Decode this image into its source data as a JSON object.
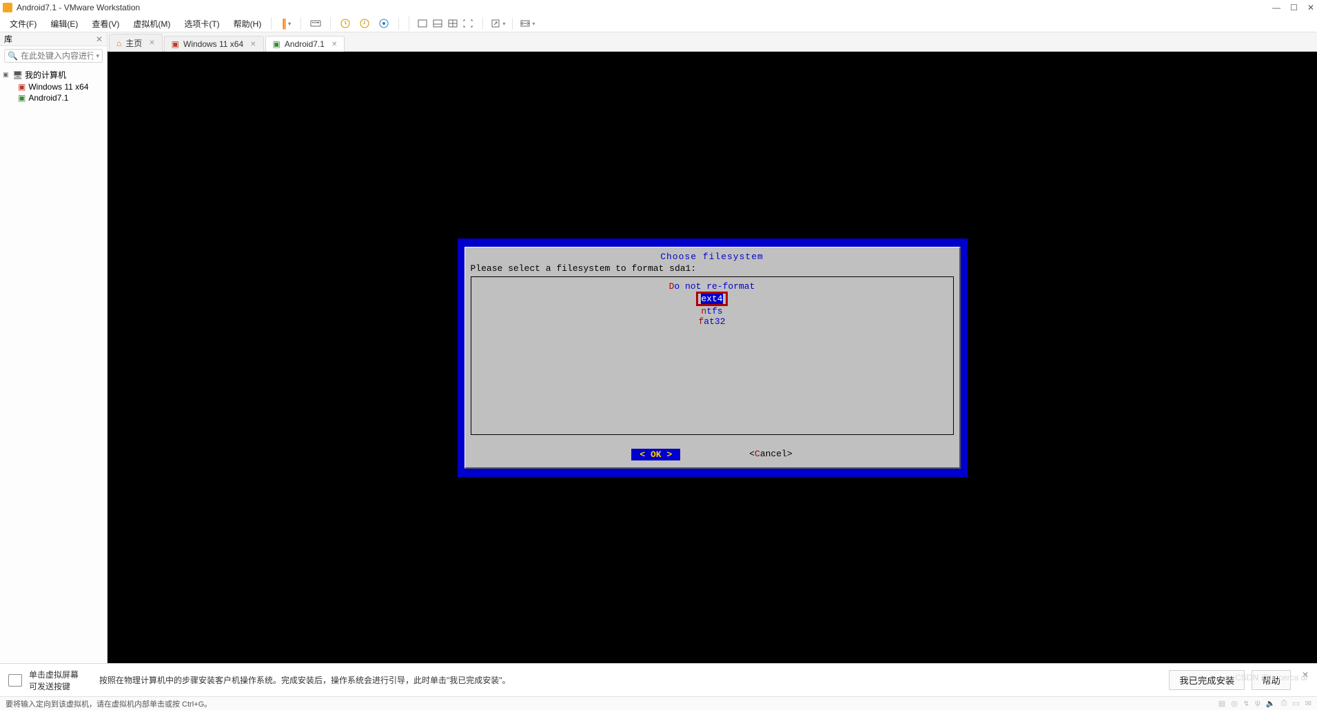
{
  "title": "Android7.1 - VMware Workstation",
  "menu": {
    "file": "文件(F)",
    "edit": "编辑(E)",
    "view": "查看(V)",
    "vm": "虚拟机(M)",
    "tab": "选项卡(T)",
    "help": "帮助(H)"
  },
  "sidebar": {
    "header": "库",
    "search_placeholder": "在此处键入内容进行搜索",
    "root": "我的计算机",
    "items": [
      {
        "label": "Windows 11 x64",
        "kind": "win"
      },
      {
        "label": "Android7.1",
        "kind": "andr"
      }
    ]
  },
  "tabs": [
    {
      "label": "主页",
      "kind": "home",
      "closable": true,
      "active": false
    },
    {
      "label": "Windows 11 x64",
      "kind": "win",
      "closable": true,
      "active": false
    },
    {
      "label": "Android7.1",
      "kind": "andr",
      "closable": true,
      "active": true
    }
  ],
  "dialog": {
    "title": "Choose filesystem",
    "prompt": "Please select a filesystem to format sda1:",
    "options": [
      {
        "hot": "D",
        "rest": "o not re-format",
        "selected": false
      },
      {
        "hot": "e",
        "rest": "xt4",
        "selected": true
      },
      {
        "hot": "n",
        "rest": "tfs",
        "selected": false
      },
      {
        "hot": "f",
        "rest": "at32",
        "selected": false
      }
    ],
    "ok": "<  OK  >",
    "cancel_left": "<",
    "cancel_hot": "C",
    "cancel_rest": "ancel>"
  },
  "install_bar": {
    "left_line1": "单击虚拟屏幕",
    "left_line2": "可发送按键",
    "message": "按照在物理计算机中的步骤安装客户机操作系统。完成安装后，操作系统会进行引导，此时单击\"我已完成安装\"。",
    "done_btn": "我已完成安装",
    "help_btn": "帮助"
  },
  "status": {
    "text": "要将输入定向到该虚拟机，请在虚拟机内部单击或按 Ctrl+G。"
  },
  "watermark": "CSDN @In cerca di"
}
